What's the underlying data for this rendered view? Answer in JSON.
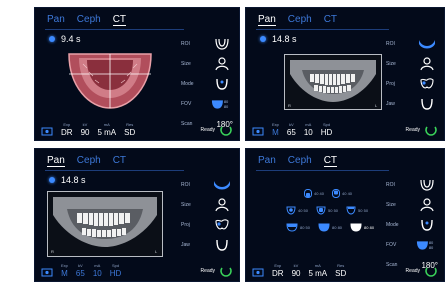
{
  "panels": [
    {
      "tabs": [
        {
          "label": "Pan",
          "active": false
        },
        {
          "label": "Ceph",
          "active": false
        },
        {
          "label": "CT",
          "active": true
        }
      ],
      "timer": "9.4 s",
      "side": [
        {
          "label": "ROI",
          "icon": "arch-outline-icon",
          "value": ""
        },
        {
          "label": "Size",
          "icon": "person-icon",
          "value": ""
        },
        {
          "label": "Mode",
          "icon": "jaw-u-icon",
          "value": ""
        },
        {
          "label": "FOV",
          "icon": "fov-icon",
          "value": "80 80"
        },
        {
          "label": "Scan",
          "icon": "",
          "value": "180°"
        }
      ],
      "bottom": [
        {
          "label": "",
          "value": "",
          "icon": "patient-icon"
        },
        {
          "label": "Exp",
          "value": "DR"
        },
        {
          "label": "kV",
          "value": "90"
        },
        {
          "label": "mA",
          "value": "5 mA"
        },
        {
          "label": "Res",
          "value": "SD"
        }
      ],
      "ready": "Ready"
    },
    {
      "tabs": [
        {
          "label": "Pan",
          "active": true
        },
        {
          "label": "Ceph",
          "active": false
        },
        {
          "label": "CT",
          "active": false
        }
      ],
      "timer": "14.8 s",
      "side": [
        {
          "label": "ROI",
          "icon": "arch-band-icon",
          "value": ""
        },
        {
          "label": "Size",
          "icon": "person-icon",
          "value": ""
        },
        {
          "label": "Proj",
          "icon": "teeth-icon",
          "value": ""
        },
        {
          "label": "Jaw",
          "icon": "jaw-u-icon",
          "value": ""
        }
      ],
      "bottom": [
        {
          "label": "",
          "value": "",
          "icon": "patient-icon"
        },
        {
          "label": "Exp",
          "value": "M"
        },
        {
          "label": "kV",
          "value": "65"
        },
        {
          "label": "mA",
          "value": "10"
        },
        {
          "label": "Spd",
          "value": "HD"
        }
      ],
      "ready": "Ready"
    },
    {
      "tabs": [
        {
          "label": "Pan",
          "active": true
        },
        {
          "label": "Ceph",
          "active": false
        },
        {
          "label": "CT",
          "active": false
        }
      ],
      "timer": "14.8 s",
      "side": [
        {
          "label": "ROI",
          "icon": "arch-band-icon",
          "value": ""
        },
        {
          "label": "Size",
          "icon": "person-icon",
          "value": ""
        },
        {
          "label": "Proj",
          "icon": "teeth-icon",
          "value": ""
        },
        {
          "label": "Jaw",
          "icon": "jaw-u-icon",
          "value": ""
        }
      ],
      "bottom": [
        {
          "label": "",
          "value": "",
          "icon": "patient-icon"
        },
        {
          "label": "Exp",
          "value": "M"
        },
        {
          "label": "kV",
          "value": "65"
        },
        {
          "label": "mA",
          "value": "10"
        },
        {
          "label": "Spd",
          "value": "HD"
        }
      ],
      "ready": "Ready"
    },
    {
      "tabs": [
        {
          "label": "Pan",
          "active": false
        },
        {
          "label": "Ceph",
          "active": false
        },
        {
          "label": "CT",
          "active": true
        }
      ],
      "timer": "",
      "side": [
        {
          "label": "ROI",
          "icon": "arch-outline-icon",
          "value": ""
        },
        {
          "label": "Size",
          "icon": "person-icon",
          "value": ""
        },
        {
          "label": "Mode",
          "icon": "jaw-u-icon",
          "value": ""
        },
        {
          "label": "FOV",
          "icon": "fov-icon",
          "value": "80 80"
        },
        {
          "label": "Scan",
          "icon": "",
          "value": "180°"
        }
      ],
      "bottom": [
        {
          "label": "",
          "value": "",
          "icon": "patient-icon"
        },
        {
          "label": "Exp",
          "value": "DR"
        },
        {
          "label": "kV",
          "value": "90"
        },
        {
          "label": "mA",
          "value": "5 mA"
        },
        {
          "label": "Res",
          "value": "SD"
        }
      ],
      "fov_options": [
        [
          "40 40",
          "40 40",
          ""
        ],
        [
          "40 50",
          "50 50",
          "50 50"
        ],
        [
          "80 50",
          "80 80",
          "80 80"
        ]
      ],
      "ready": "Ready"
    }
  ],
  "colors": {
    "panel_bg": "#030a1a",
    "accent": "#3c8aff",
    "ready_ring": "#3ad35a",
    "arch": "#c9727a"
  }
}
